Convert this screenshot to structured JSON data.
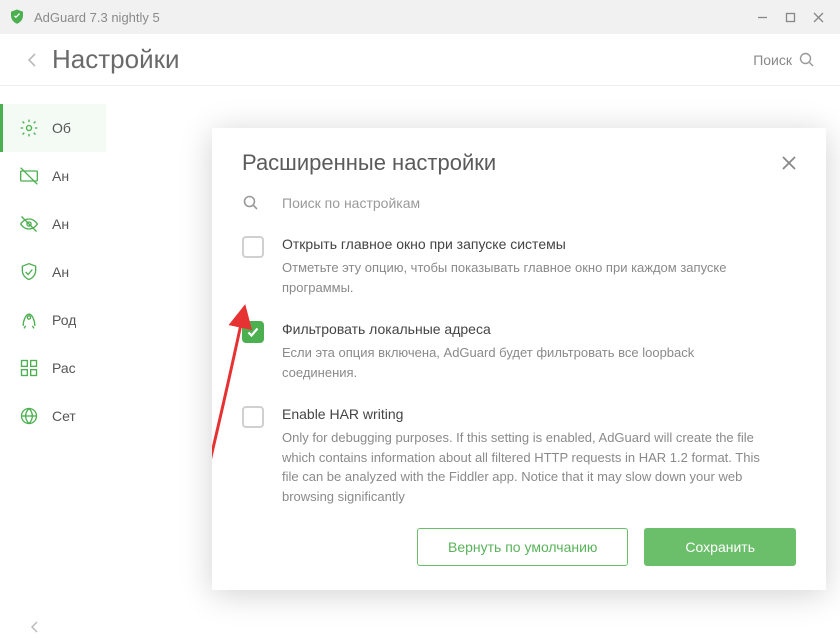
{
  "window": {
    "title": "AdGuard 7.3 nightly 5"
  },
  "header": {
    "page_title": "Настройки",
    "search_label": "Поиск"
  },
  "sidebar": {
    "items": [
      {
        "label": "Об"
      },
      {
        "label": "Ан"
      },
      {
        "label": "Ан"
      },
      {
        "label": "Ан"
      },
      {
        "label": "Род"
      },
      {
        "label": "Рас"
      },
      {
        "label": "Сет"
      }
    ]
  },
  "modal": {
    "title": "Расширенные настройки",
    "search_placeholder": "Поиск по настройкам",
    "settings": [
      {
        "checked": false,
        "title": "Открыть главное окно при запуске системы",
        "desc": "Отметьте эту опцию, чтобы показывать главное окно при каждом запуске программы."
      },
      {
        "checked": true,
        "title": "Фильтровать локальные адреса",
        "desc": "Если эта опция включена, AdGuard будет фильтровать все loopback соединения."
      },
      {
        "checked": false,
        "title": "Enable HAR writing",
        "desc": "Only for debugging purposes. If this setting is enabled, AdGuard will create the file which contains information about all filtered HTTP requests in HAR 1.2 format. This file can be analyzed with the Fiddler app. Notice that it may slow down your web browsing significantly"
      }
    ],
    "buttons": {
      "reset": "Вернуть по умолчанию",
      "save": "Сохранить"
    }
  }
}
